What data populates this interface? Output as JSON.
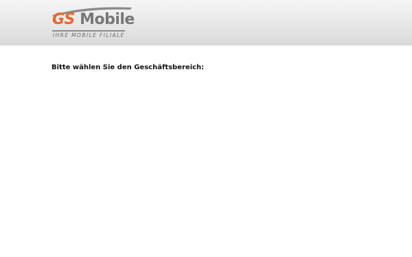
{
  "header": {
    "logo": {
      "brand_part_1": "GS",
      "brand_part_2": " Mobile",
      "tagline": "IHRE MOBILE FILIALE",
      "colors": {
        "accent": "#e8692a",
        "text": "#777777",
        "green_dot": "#6aa84f"
      }
    }
  },
  "main": {
    "prompt": "Bitte wählen Sie den Geschäftsbereich:"
  }
}
